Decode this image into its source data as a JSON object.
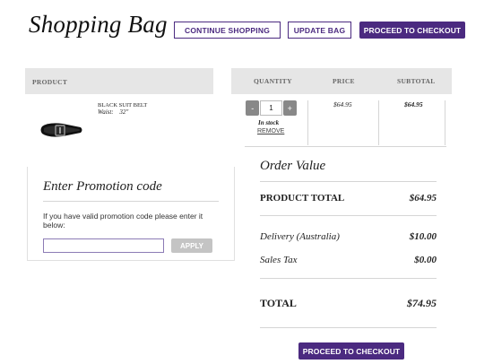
{
  "page": {
    "title": "Shopping Bag"
  },
  "toolbar": {
    "continue_label": "CONTINUE SHOPPING",
    "update_label": "UPDATE BAG",
    "checkout_label": "PROCEED TO CHECKOUT"
  },
  "table": {
    "headers": {
      "product": "PRODUCT",
      "quantity": "QUANTITY",
      "price": "PRICE",
      "subtotal": "SUBTOTAL"
    },
    "item": {
      "name": "BLACK SUIT BELT",
      "attr_label": "Waist:",
      "attr_value": "32\"",
      "quantity": "1",
      "minus": "-",
      "plus": "+",
      "stock": "In stock",
      "remove": "REMOVE",
      "price": "$64.95",
      "subtotal": "$64.95"
    }
  },
  "promo": {
    "title": "Enter Promotion code",
    "text": "If you have valid promotion code please enter it below:",
    "input_value": "",
    "apply_label": "APPLY"
  },
  "order": {
    "title": "Order Value",
    "product_total_label": "PRODUCT TOTAL",
    "product_total": "$64.95",
    "delivery_label": "Delivery (Australia)",
    "delivery": "$10.00",
    "tax_label": "Sales Tax",
    "tax": "$0.00",
    "total_label": "TOTAL",
    "total": "$74.95",
    "checkout_label": "PROCEED TO CHECKOUT"
  },
  "colors": {
    "accent": "#4b2a80",
    "header_bg": "#e6e6e6",
    "stepper": "#888888",
    "apply_bg": "#c4c4c4"
  },
  "icons": {
    "product_image": "belt-image"
  }
}
